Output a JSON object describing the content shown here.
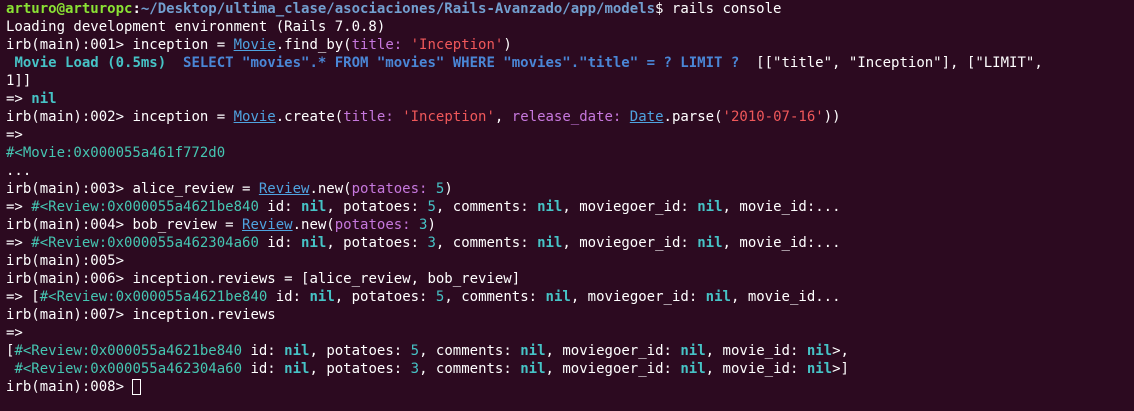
{
  "colors": {
    "background": "#2c0a20",
    "default_text": "#ffffff",
    "prompt_user": "#8ae234",
    "prompt_path": "#729fcf",
    "constant": "#4fa3e0",
    "symbol": "#c678dd",
    "string": "#f0585a",
    "number_nil": "#46c3c6",
    "object_ref": "#45c6b2",
    "sql": "#4a86d6"
  },
  "terminal": {
    "prompt_user": "arturo@arturopc",
    "prompt_sep": ":",
    "prompt_path": "~/Desktop/ultima_clase/asociaciones/Rails-Avanzado/app/models",
    "prompt_end": "$ ",
    "command": "rails console",
    "loading": "Loading development environment (Rails 7.0.8)",
    "irb": [
      "irb(main):001> ",
      "irb(main):002> ",
      "irb(main):003> ",
      "irb(main):004> ",
      "irb(main):005>",
      "irb(main):006> ",
      "irb(main):007> ",
      "irb(main):008> "
    ],
    "arrow": "=> ",
    "arrow_bare": "=>",
    "ellipsis": "...",
    "nil": "nil",
    "line1": {
      "var": "inception = ",
      "const": "Movie",
      "method": ".find_by(",
      "sym": "title: ",
      "str": "'Inception'",
      "close": ")"
    },
    "sql_log": {
      "label": "Movie Load (0.5ms)",
      "query_head": "  SELECT \"movies\".* FROM \"movies\" WHERE \"movies\".\"title\" = ? LIMIT ?",
      "binds": "  [[\"title\", \"Inception\"], [\"LIMIT\",",
      "binds_cont": "1]]"
    },
    "line2": {
      "var": "inception = ",
      "const": "Movie",
      "method": ".create(",
      "sym1": "title: ",
      "str1": "'Inception'",
      "comma": ", ",
      "sym2": "release_date: ",
      "const2": "Date",
      "method2": ".parse(",
      "str2": "'2010-07-16'",
      "close": "))"
    },
    "movie_obj": "#<Movie:0x000055a461f772d0",
    "line3": {
      "var": "alice_review = ",
      "const": "Review",
      "method": ".new(",
      "sym": "potatoes: ",
      "num": "5",
      "close": ")"
    },
    "line4": {
      "var": "bob_review = ",
      "const": "Review",
      "method": ".new(",
      "sym": "potatoes: ",
      "num": "3",
      "close": ")"
    },
    "review_a": "#<Review:0x000055a4621be840",
    "review_b": "#<Review:0x000055a462304a60",
    "attr_id": " id: ",
    "attr_potatoes": ", potatoes: ",
    "attr_comments": ", comments: ",
    "attr_moviegoer": ", moviegoer_id: ",
    "attr_movie_trunc": ", movie_id:...",
    "attr_movie_trunc2": ", movie_id...",
    "attr_movie_full": ", movie_id: ",
    "num5": "5",
    "num3": "3",
    "line6_cmd": "inception.reviews = [alice_review, bob_review]",
    "line7_cmd": "inception.reviews",
    "bracket_open": "[",
    "space": " ",
    "close_angle_comma": ">,",
    "close_angle_bracket": ">]"
  }
}
